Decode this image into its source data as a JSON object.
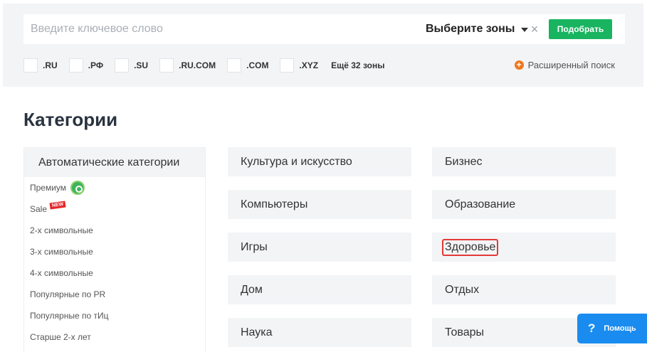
{
  "search": {
    "placeholder": "Введите ключевое слово",
    "zones_label": "Выберите зоны",
    "clear_symbol": "×",
    "pick_label": "Подобрать"
  },
  "zones": [
    ".RU",
    ".РФ",
    ".SU",
    ".RU.COM",
    ".COM",
    ".XYZ"
  ],
  "more_zones": "Ещё 32 зоны",
  "advanced_search": "Расширенный поиск",
  "page_title": "Категории",
  "auto_categories": {
    "title": "Автоматические категории",
    "items": [
      "Премиум",
      "Sale",
      "2-х символьные",
      "3-х символьные",
      "4-х символьные",
      "Популярные по PR",
      "Популярные по тИц",
      "Старше 2-х лет"
    ],
    "new_badge": "NEW"
  },
  "categories": {
    "col1": [
      "Культура и искусство",
      "Компьютеры",
      "Игры",
      "Дом",
      "Наука"
    ],
    "col2": [
      "Бизнес",
      "Образование",
      "Здоровье",
      "Отдых",
      "Товары"
    ]
  },
  "help": {
    "icon": "?",
    "label": "Помощь"
  },
  "colors": {
    "accent_green": "#18b460",
    "help_blue": "#1a8cf0",
    "highlight_red": "#e53935",
    "plus_orange": "#f0771f"
  }
}
